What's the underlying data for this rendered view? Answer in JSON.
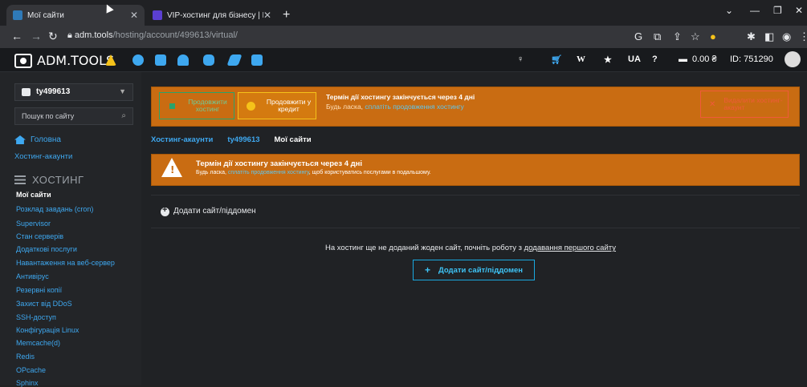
{
  "browser": {
    "tabs": [
      {
        "title": "Мої сайти",
        "active": true
      },
      {
        "title": "VIP-хостинг для бізнесу | Бізнес",
        "active": false
      }
    ],
    "url_host": "adm.tools",
    "url_path": "/hosting/account/499613/virtual/"
  },
  "header": {
    "logo": "ADM.TOOLS",
    "lang": "UA",
    "balance": "0.00 ₴",
    "user_id": "ID: 751290"
  },
  "sidebar": {
    "account": "ty499613",
    "search_placeholder": "Пошук по сайту",
    "home": "Головна",
    "hosting_accounts": "Хостинг-акаунти",
    "section": "ХОСТИНГ",
    "items": [
      "Мої сайти",
      "Розклад завдань (cron)",
      "Supervisor",
      "Стан серверів",
      "Додаткові послуги",
      "Навантаження на веб-сервер",
      "Антивірус",
      "Резервні копії",
      "Захист від DDoS",
      "SSH-доступ",
      "Конфігурація Linux",
      "Memcache(d)",
      "Redis",
      "OPcache",
      "Sphinx"
    ],
    "active_index": 0
  },
  "banner_top": {
    "renew_label": "Продовжити хостинг",
    "credit_label": "Продовжити у кредит",
    "title": "Термін дії хостингу закінчується через 4 дні",
    "text_prefix": "Будь ласка, ",
    "text_link": "сплатіть продовження хостингу",
    "delete_label": "Видалити хостинг-акаунт"
  },
  "breadcrumbs": [
    "Хостинг-акаунти",
    "ty499613",
    "Мої сайти"
  ],
  "banner_warning": {
    "title": "Термін дії хостингу закінчується через 4 дні",
    "text_prefix": "Будь ласка, ",
    "text_link": "сплатіть продовження хостингу",
    "text_suffix": ", щоб користуватись послугами в подальшому."
  },
  "main": {
    "add_site_label": "Додати сайт/піддомен",
    "empty_prefix": "На хостинг ще не доданий жоден сайт, почніть роботу з ",
    "empty_link": "додавання першого сайту",
    "add_button": "Додати сайт/піддомен"
  },
  "colors": {
    "accent": "#3ea8f0",
    "warning": "#c96c12",
    "success": "#2aa36a",
    "danger": "#ef5a3a"
  }
}
